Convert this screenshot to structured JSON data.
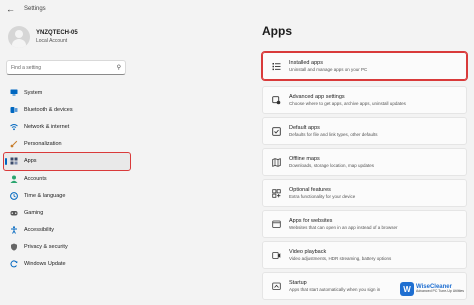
{
  "window": {
    "title": "Settings",
    "back_icon": "back-arrow-icon"
  },
  "profile": {
    "username": "YNZQTECH-05",
    "account_type": "Local Account"
  },
  "search": {
    "placeholder": "Find a setting",
    "icon": "search-icon"
  },
  "sidebar": {
    "items": [
      {
        "label": "System",
        "icon": "monitor-icon",
        "color": "#0067c0"
      },
      {
        "label": "Bluetooth & devices",
        "icon": "bluetooth-icon",
        "color": "#0067c0"
      },
      {
        "label": "Network & internet",
        "icon": "wifi-icon",
        "color": "#0067c0"
      },
      {
        "label": "Personalization",
        "icon": "brush-icon",
        "color": "#c77c29"
      },
      {
        "label": "Apps",
        "icon": "apps-icon",
        "color": "#3a4a6a",
        "active": true
      },
      {
        "label": "Accounts",
        "icon": "person-icon",
        "color": "#2aa56f"
      },
      {
        "label": "Time & language",
        "icon": "globe-clock-icon",
        "color": "#0067c0"
      },
      {
        "label": "Gaming",
        "icon": "gamepad-icon",
        "color": "#555555"
      },
      {
        "label": "Accessibility",
        "icon": "accessibility-icon",
        "color": "#0067c0"
      },
      {
        "label": "Privacy & security",
        "icon": "shield-icon",
        "color": "#555555"
      },
      {
        "label": "Windows Update",
        "icon": "update-icon",
        "color": "#0067c0"
      }
    ]
  },
  "main": {
    "title": "Apps",
    "cards": [
      {
        "title": "Installed apps",
        "desc": "Uninstall and manage apps on your PC",
        "icon": "list-icon",
        "highlight": true
      },
      {
        "title": "Advanced app settings",
        "desc": "Choose where to get apps, archive apps, uninstall updates",
        "icon": "app-settings-icon"
      },
      {
        "title": "Default apps",
        "desc": "Defaults for file and link types, other defaults",
        "icon": "default-apps-icon"
      },
      {
        "title": "Offline maps",
        "desc": "Downloads, storage location, map updates",
        "icon": "map-icon"
      },
      {
        "title": "Optional features",
        "desc": "Extra functionality for your device",
        "icon": "features-icon"
      },
      {
        "title": "Apps for websites",
        "desc": "Websites that can open in an app instead of a browser",
        "icon": "web-apps-icon"
      },
      {
        "title": "Video playback",
        "desc": "Video adjustments, HDR streaming, battery options",
        "icon": "video-icon"
      },
      {
        "title": "Startup",
        "desc": "Apps that start automatically when you sign in",
        "icon": "startup-icon"
      }
    ]
  },
  "watermark": {
    "name": "WiseCleaner",
    "tagline": "Advanced PC Tune-Up Utilities"
  },
  "colors": {
    "accent": "#0067c0",
    "highlight": "#d93a3a"
  }
}
